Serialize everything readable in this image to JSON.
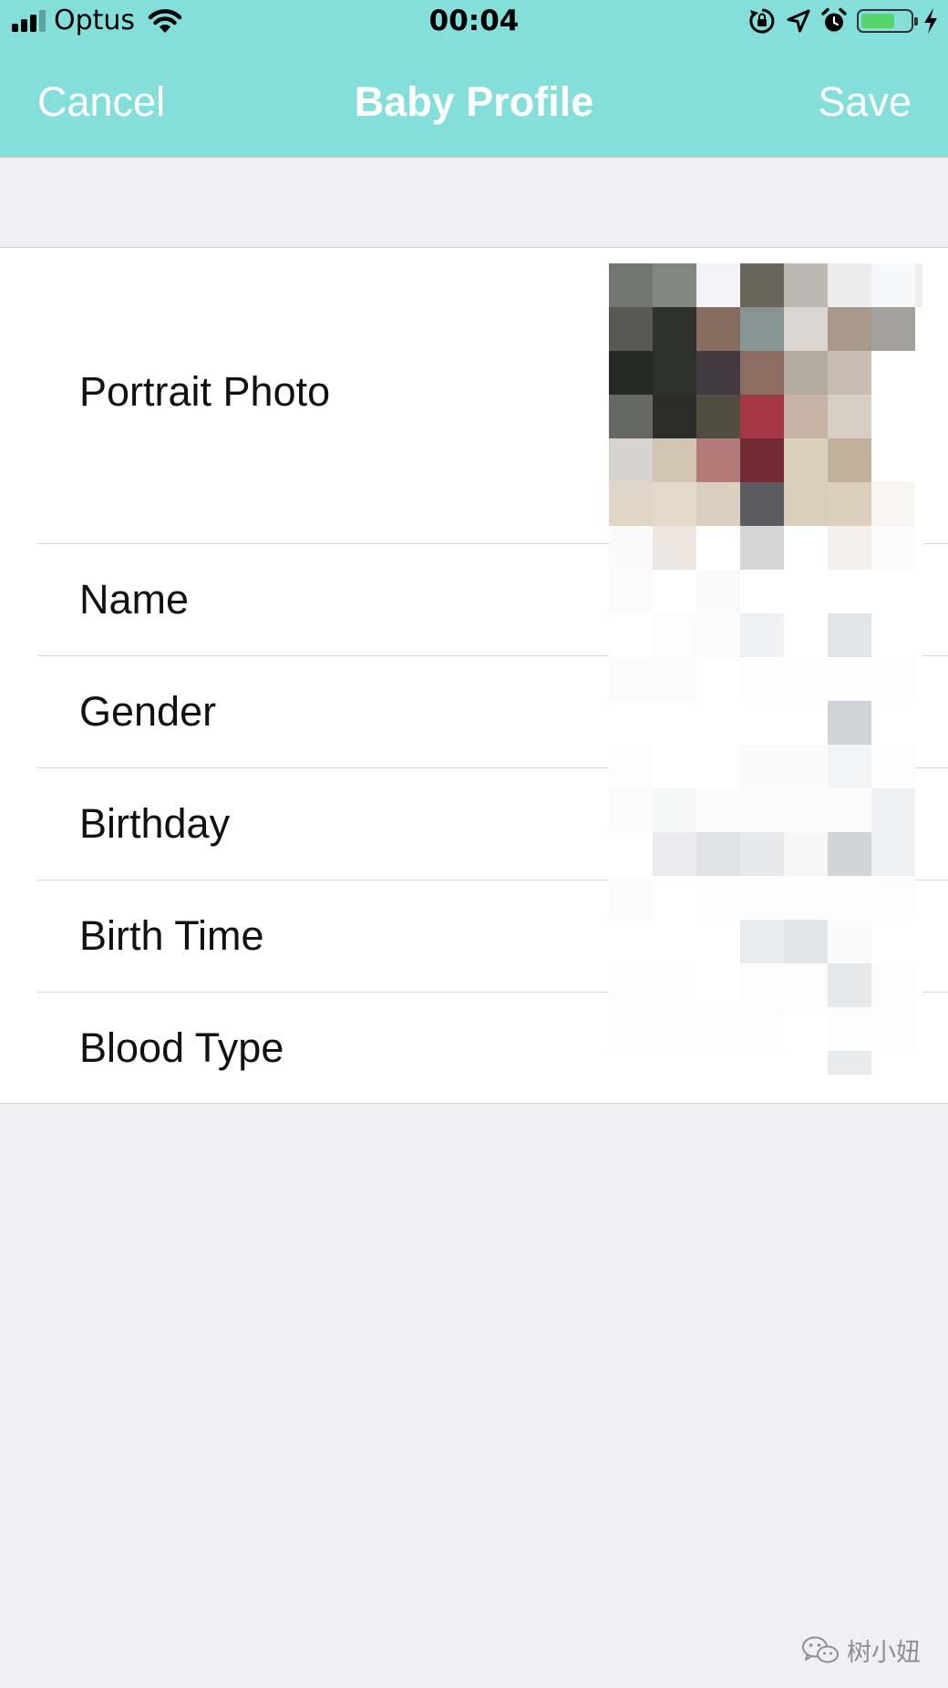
{
  "status_bar": {
    "carrier": "Optus",
    "time": "00:04",
    "signal_bars_active": 3,
    "signal_bars_total": 4,
    "battery_level": 0.65,
    "icons": [
      "signal-icon",
      "wifi-icon",
      "orientation-lock-icon",
      "location-icon",
      "alarm-icon",
      "battery-icon",
      "charging-icon"
    ]
  },
  "nav": {
    "cancel_label": "Cancel",
    "title": "Baby Profile",
    "save_label": "Save"
  },
  "profile": {
    "rows": [
      {
        "label": "Portrait Photo"
      },
      {
        "label": "Name"
      },
      {
        "label": "Gender"
      },
      {
        "label": "Birthday"
      },
      {
        "label": "Birth Time"
      },
      {
        "label": "Blood Type"
      }
    ],
    "photo_state": "pixelated"
  },
  "watermark": {
    "text": "树小妞",
    "icon": "wechat-icon"
  },
  "colors": {
    "nav_bar": "#84dfdb",
    "nav_text": "#ffffff",
    "page_background": "#efeff4",
    "cell_background": "#ffffff",
    "separator": "#d6d6da",
    "battery_fill": "#58d36c"
  }
}
